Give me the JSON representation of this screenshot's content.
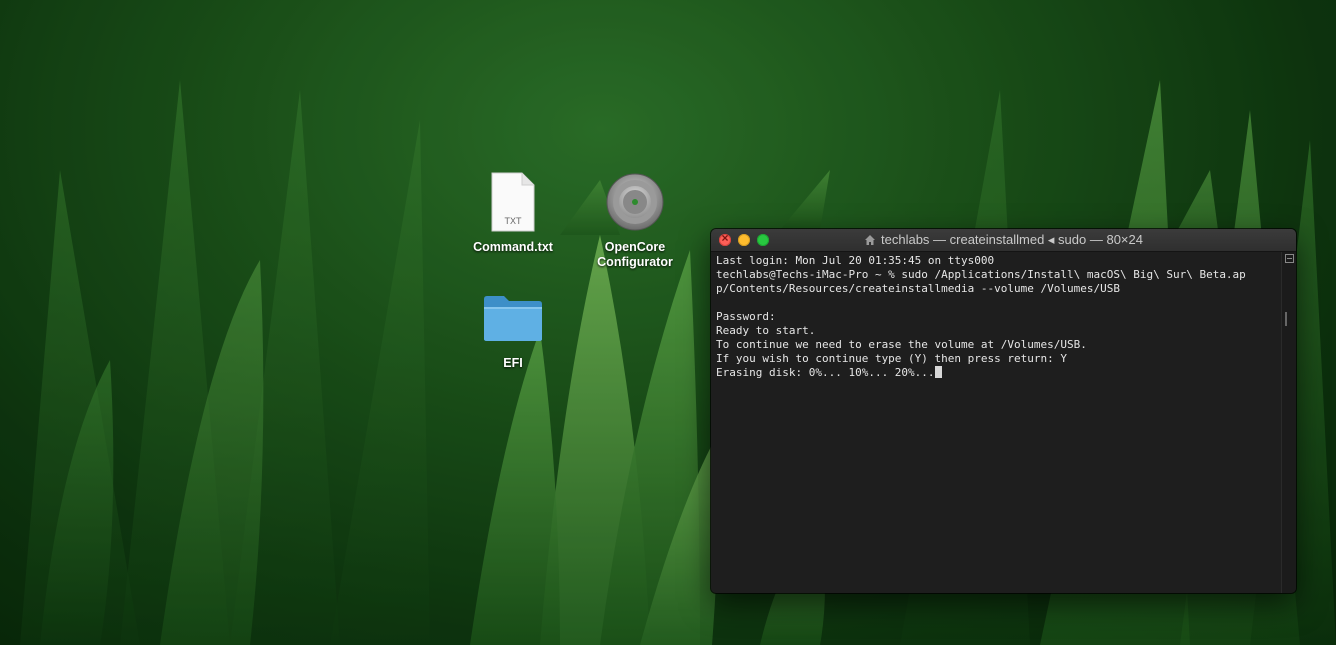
{
  "desktop": {
    "icons": [
      {
        "label": "Command.txt",
        "badge": "TXT",
        "icon": "text-file-icon"
      },
      {
        "label": "OpenCore\nConfigurator",
        "icon": "opencore-app-icon"
      },
      {
        "label": "EFI",
        "icon": "folder-icon"
      }
    ]
  },
  "terminal": {
    "title": "techlabs — createinstallmed ◂ sudo — 80×24",
    "lines": [
      "Last login: Mon Jul 20 01:35:45 on ttys000",
      "techlabs@Techs-iMac-Pro ~ % sudo /Applications/Install\\ macOS\\ Big\\ Sur\\ Beta.ap",
      "p/Contents/Resources/createinstallmedia --volume /Volumes/USB",
      "",
      "Password:",
      "Ready to start.",
      "To continue we need to erase the volume at /Volumes/USB.",
      "If you wish to continue type (Y) then press return: Y",
      "Erasing disk: 0%... 10%... 20%..."
    ]
  },
  "colors": {
    "close": "#fd5f57",
    "minimize": "#febc2e",
    "maximize": "#28c840",
    "terminal_bg": "#1e1e1e"
  }
}
